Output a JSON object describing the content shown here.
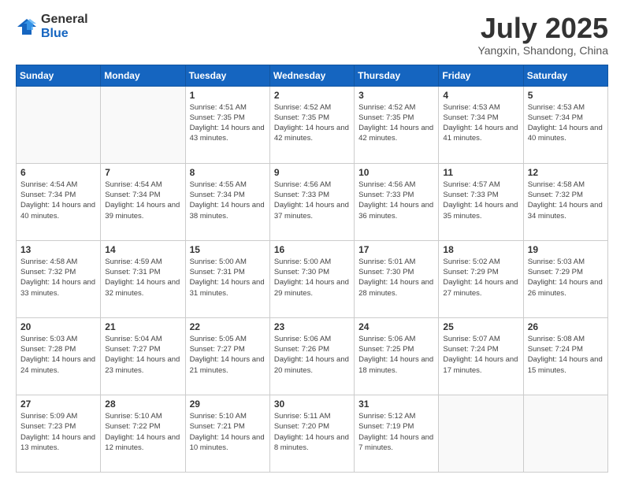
{
  "logo": {
    "general": "General",
    "blue": "Blue"
  },
  "header": {
    "month": "July 2025",
    "location": "Yangxin, Shandong, China"
  },
  "weekdays": [
    "Sunday",
    "Monday",
    "Tuesday",
    "Wednesday",
    "Thursday",
    "Friday",
    "Saturday"
  ],
  "weeks": [
    [
      {
        "day": "",
        "sunrise": "",
        "sunset": "",
        "daylight": ""
      },
      {
        "day": "",
        "sunrise": "",
        "sunset": "",
        "daylight": ""
      },
      {
        "day": "1",
        "sunrise": "Sunrise: 4:51 AM",
        "sunset": "Sunset: 7:35 PM",
        "daylight": "Daylight: 14 hours and 43 minutes."
      },
      {
        "day": "2",
        "sunrise": "Sunrise: 4:52 AM",
        "sunset": "Sunset: 7:35 PM",
        "daylight": "Daylight: 14 hours and 42 minutes."
      },
      {
        "day": "3",
        "sunrise": "Sunrise: 4:52 AM",
        "sunset": "Sunset: 7:35 PM",
        "daylight": "Daylight: 14 hours and 42 minutes."
      },
      {
        "day": "4",
        "sunrise": "Sunrise: 4:53 AM",
        "sunset": "Sunset: 7:34 PM",
        "daylight": "Daylight: 14 hours and 41 minutes."
      },
      {
        "day": "5",
        "sunrise": "Sunrise: 4:53 AM",
        "sunset": "Sunset: 7:34 PM",
        "daylight": "Daylight: 14 hours and 40 minutes."
      }
    ],
    [
      {
        "day": "6",
        "sunrise": "Sunrise: 4:54 AM",
        "sunset": "Sunset: 7:34 PM",
        "daylight": "Daylight: 14 hours and 40 minutes."
      },
      {
        "day": "7",
        "sunrise": "Sunrise: 4:54 AM",
        "sunset": "Sunset: 7:34 PM",
        "daylight": "Daylight: 14 hours and 39 minutes."
      },
      {
        "day": "8",
        "sunrise": "Sunrise: 4:55 AM",
        "sunset": "Sunset: 7:34 PM",
        "daylight": "Daylight: 14 hours and 38 minutes."
      },
      {
        "day": "9",
        "sunrise": "Sunrise: 4:56 AM",
        "sunset": "Sunset: 7:33 PM",
        "daylight": "Daylight: 14 hours and 37 minutes."
      },
      {
        "day": "10",
        "sunrise": "Sunrise: 4:56 AM",
        "sunset": "Sunset: 7:33 PM",
        "daylight": "Daylight: 14 hours and 36 minutes."
      },
      {
        "day": "11",
        "sunrise": "Sunrise: 4:57 AM",
        "sunset": "Sunset: 7:33 PM",
        "daylight": "Daylight: 14 hours and 35 minutes."
      },
      {
        "day": "12",
        "sunrise": "Sunrise: 4:58 AM",
        "sunset": "Sunset: 7:32 PM",
        "daylight": "Daylight: 14 hours and 34 minutes."
      }
    ],
    [
      {
        "day": "13",
        "sunrise": "Sunrise: 4:58 AM",
        "sunset": "Sunset: 7:32 PM",
        "daylight": "Daylight: 14 hours and 33 minutes."
      },
      {
        "day": "14",
        "sunrise": "Sunrise: 4:59 AM",
        "sunset": "Sunset: 7:31 PM",
        "daylight": "Daylight: 14 hours and 32 minutes."
      },
      {
        "day": "15",
        "sunrise": "Sunrise: 5:00 AM",
        "sunset": "Sunset: 7:31 PM",
        "daylight": "Daylight: 14 hours and 31 minutes."
      },
      {
        "day": "16",
        "sunrise": "Sunrise: 5:00 AM",
        "sunset": "Sunset: 7:30 PM",
        "daylight": "Daylight: 14 hours and 29 minutes."
      },
      {
        "day": "17",
        "sunrise": "Sunrise: 5:01 AM",
        "sunset": "Sunset: 7:30 PM",
        "daylight": "Daylight: 14 hours and 28 minutes."
      },
      {
        "day": "18",
        "sunrise": "Sunrise: 5:02 AM",
        "sunset": "Sunset: 7:29 PM",
        "daylight": "Daylight: 14 hours and 27 minutes."
      },
      {
        "day": "19",
        "sunrise": "Sunrise: 5:03 AM",
        "sunset": "Sunset: 7:29 PM",
        "daylight": "Daylight: 14 hours and 26 minutes."
      }
    ],
    [
      {
        "day": "20",
        "sunrise": "Sunrise: 5:03 AM",
        "sunset": "Sunset: 7:28 PM",
        "daylight": "Daylight: 14 hours and 24 minutes."
      },
      {
        "day": "21",
        "sunrise": "Sunrise: 5:04 AM",
        "sunset": "Sunset: 7:27 PM",
        "daylight": "Daylight: 14 hours and 23 minutes."
      },
      {
        "day": "22",
        "sunrise": "Sunrise: 5:05 AM",
        "sunset": "Sunset: 7:27 PM",
        "daylight": "Daylight: 14 hours and 21 minutes."
      },
      {
        "day": "23",
        "sunrise": "Sunrise: 5:06 AM",
        "sunset": "Sunset: 7:26 PM",
        "daylight": "Daylight: 14 hours and 20 minutes."
      },
      {
        "day": "24",
        "sunrise": "Sunrise: 5:06 AM",
        "sunset": "Sunset: 7:25 PM",
        "daylight": "Daylight: 14 hours and 18 minutes."
      },
      {
        "day": "25",
        "sunrise": "Sunrise: 5:07 AM",
        "sunset": "Sunset: 7:24 PM",
        "daylight": "Daylight: 14 hours and 17 minutes."
      },
      {
        "day": "26",
        "sunrise": "Sunrise: 5:08 AM",
        "sunset": "Sunset: 7:24 PM",
        "daylight": "Daylight: 14 hours and 15 minutes."
      }
    ],
    [
      {
        "day": "27",
        "sunrise": "Sunrise: 5:09 AM",
        "sunset": "Sunset: 7:23 PM",
        "daylight": "Daylight: 14 hours and 13 minutes."
      },
      {
        "day": "28",
        "sunrise": "Sunrise: 5:10 AM",
        "sunset": "Sunset: 7:22 PM",
        "daylight": "Daylight: 14 hours and 12 minutes."
      },
      {
        "day": "29",
        "sunrise": "Sunrise: 5:10 AM",
        "sunset": "Sunset: 7:21 PM",
        "daylight": "Daylight: 14 hours and 10 minutes."
      },
      {
        "day": "30",
        "sunrise": "Sunrise: 5:11 AM",
        "sunset": "Sunset: 7:20 PM",
        "daylight": "Daylight: 14 hours and 8 minutes."
      },
      {
        "day": "31",
        "sunrise": "Sunrise: 5:12 AM",
        "sunset": "Sunset: 7:19 PM",
        "daylight": "Daylight: 14 hours and 7 minutes."
      },
      {
        "day": "",
        "sunrise": "",
        "sunset": "",
        "daylight": ""
      },
      {
        "day": "",
        "sunrise": "",
        "sunset": "",
        "daylight": ""
      }
    ]
  ]
}
